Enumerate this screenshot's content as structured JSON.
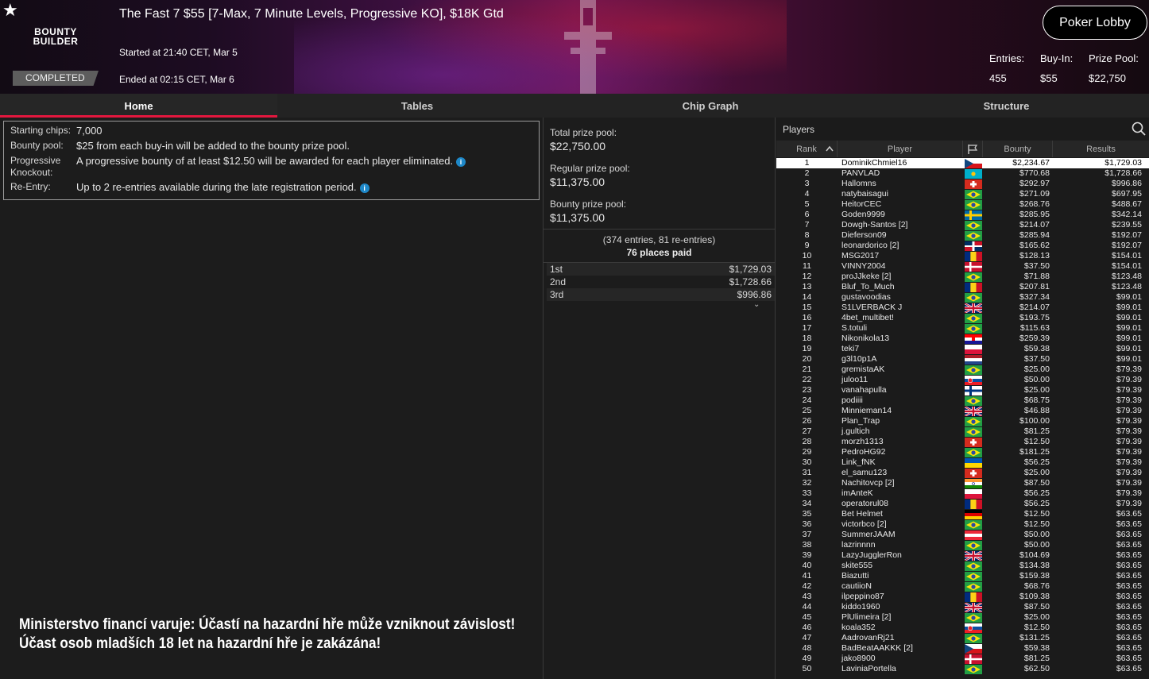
{
  "header": {
    "logo_line1": "BOUNTY",
    "logo_line2": "BUILDER",
    "status": "COMPLETED",
    "title": "The Fast 7 $55 [7-Max, 7 Minute Levels, Progressive KO], $18K Gtd",
    "started": "Started at 21:40 CET, Mar 5",
    "ended": "Ended at 02:15 CET, Mar 6",
    "lobby_button": "Poker Lobby",
    "stats": [
      {
        "label": "Entries:",
        "value": "455"
      },
      {
        "label": "Buy-In:",
        "value": "$55"
      },
      {
        "label": "Prize Pool:",
        "value": "$22,750"
      }
    ]
  },
  "tabs": [
    "Home",
    "Tables",
    "Chip Graph",
    "Structure"
  ],
  "info": {
    "rows": [
      {
        "key": "Starting chips:",
        "value": "7,000",
        "info": false
      },
      {
        "key": "Bounty pool:",
        "value": "$25 from each buy-in will be added to the bounty prize pool.",
        "info": false
      },
      {
        "key": "Progressive Knockout:",
        "value": "A progressive bounty of at least $12.50 will be awarded for each player eliminated.",
        "info": true
      },
      {
        "key": "Re-Entry:",
        "value": "Up to 2 re-entries available during the late registration period.",
        "info": true
      }
    ]
  },
  "warning": {
    "line1": "Ministerstvo financí varuje: Účastí na hazardní hře může vzniknout závislost!",
    "line2": "Účast osob mladších 18 let na hazardní hře je zakázána!"
  },
  "prizes": {
    "total_label": "Total prize pool:",
    "total_value": "$22,750.00",
    "regular_label": "Regular prize pool:",
    "regular_value": "$11,375.00",
    "bounty_label": "Bounty prize pool:",
    "bounty_value": "$11,375.00",
    "entries_note": "(374 entries, 81 re-entries)",
    "places_paid": "76 places paid",
    "payouts": [
      {
        "place": "1st",
        "amount": "$1,729.03"
      },
      {
        "place": "2nd",
        "amount": "$1,728.66"
      },
      {
        "place": "3rd",
        "amount": "$996.86"
      }
    ]
  },
  "players": {
    "title": "Players",
    "columns": {
      "rank": "Rank",
      "player": "Player",
      "bounty": "Bounty",
      "results": "Results"
    },
    "rows": [
      {
        "rank": "1",
        "name": "DominikChmiel16",
        "flag": "cz",
        "bounty": "$2,234.67",
        "result": "$1,729.03"
      },
      {
        "rank": "2",
        "name": "PANVLAD",
        "flag": "kz",
        "bounty": "$770.68",
        "result": "$1,728.66"
      },
      {
        "rank": "3",
        "name": "Hallomns",
        "flag": "ch",
        "bounty": "$292.97",
        "result": "$996.86"
      },
      {
        "rank": "4",
        "name": "natybaisagui",
        "flag": "br",
        "bounty": "$271.09",
        "result": "$697.95"
      },
      {
        "rank": "5",
        "name": "HeitorCEC",
        "flag": "br",
        "bounty": "$268.76",
        "result": "$488.67"
      },
      {
        "rank": "6",
        "name": "Goden9999",
        "flag": "se",
        "bounty": "$285.95",
        "result": "$342.14"
      },
      {
        "rank": "7",
        "name": "Dowgh-Santos [2]",
        "flag": "br",
        "bounty": "$214.07",
        "result": "$239.55"
      },
      {
        "rank": "8",
        "name": "Dieferson09",
        "flag": "br",
        "bounty": "$285.94",
        "result": "$192.07"
      },
      {
        "rank": "9",
        "name": "leonardorico [2]",
        "flag": "do",
        "bounty": "$165.62",
        "result": "$192.07"
      },
      {
        "rank": "10",
        "name": "MSG2017",
        "flag": "ro",
        "bounty": "$128.13",
        "result": "$154.01"
      },
      {
        "rank": "11",
        "name": "VINNY2004",
        "flag": "dk",
        "bounty": "$37.50",
        "result": "$154.01"
      },
      {
        "rank": "12",
        "name": "proJJkeke [2]",
        "flag": "br",
        "bounty": "$71.88",
        "result": "$123.48"
      },
      {
        "rank": "13",
        "name": "Bluf_To_Much",
        "flag": "ro",
        "bounty": "$207.81",
        "result": "$123.48"
      },
      {
        "rank": "14",
        "name": "gustavoodias",
        "flag": "br",
        "bounty": "$327.34",
        "result": "$99.01"
      },
      {
        "rank": "15",
        "name": "S1LVERBACK J",
        "flag": "gb",
        "bounty": "$214.07",
        "result": "$99.01"
      },
      {
        "rank": "16",
        "name": "4bet_multibet!",
        "flag": "br",
        "bounty": "$193.75",
        "result": "$99.01"
      },
      {
        "rank": "17",
        "name": "S.totuli",
        "flag": "br",
        "bounty": "$115.63",
        "result": "$99.01"
      },
      {
        "rank": "18",
        "name": "Nikonikola13",
        "flag": "hr",
        "bounty": "$259.39",
        "result": "$99.01"
      },
      {
        "rank": "19",
        "name": "teki7",
        "flag": "pl",
        "bounty": "$59.38",
        "result": "$99.01"
      },
      {
        "rank": "20",
        "name": "g3l10p1A",
        "flag": "nl",
        "bounty": "$37.50",
        "result": "$99.01"
      },
      {
        "rank": "21",
        "name": "gremistaAK",
        "flag": "br",
        "bounty": "$25.00",
        "result": "$79.39"
      },
      {
        "rank": "22",
        "name": "juloo11",
        "flag": "sk",
        "bounty": "$50.00",
        "result": "$79.39"
      },
      {
        "rank": "23",
        "name": "vanahapulla",
        "flag": "fi",
        "bounty": "$25.00",
        "result": "$79.39"
      },
      {
        "rank": "24",
        "name": "podiiii",
        "flag": "br",
        "bounty": "$68.75",
        "result": "$79.39"
      },
      {
        "rank": "25",
        "name": "Minnieman14",
        "flag": "gb",
        "bounty": "$46.88",
        "result": "$79.39"
      },
      {
        "rank": "26",
        "name": "Plan_Trap",
        "flag": "br",
        "bounty": "$100.00",
        "result": "$79.39"
      },
      {
        "rank": "27",
        "name": "j.gultich",
        "flag": "br",
        "bounty": "$81.25",
        "result": "$79.39"
      },
      {
        "rank": "28",
        "name": "morzh1313",
        "flag": "ch",
        "bounty": "$12.50",
        "result": "$79.39"
      },
      {
        "rank": "29",
        "name": "PedroHG92",
        "flag": "br",
        "bounty": "$181.25",
        "result": "$79.39"
      },
      {
        "rank": "30",
        "name": "Link_fNK",
        "flag": "ua",
        "bounty": "$56.25",
        "result": "$79.39"
      },
      {
        "rank": "31",
        "name": "el_samu123",
        "flag": "ch",
        "bounty": "$25.00",
        "result": "$79.39"
      },
      {
        "rank": "32",
        "name": "Nachitovcp [2]",
        "flag": "in",
        "bounty": "$87.50",
        "result": "$79.39"
      },
      {
        "rank": "33",
        "name": "imAnteK",
        "flag": "pl",
        "bounty": "$56.25",
        "result": "$79.39"
      },
      {
        "rank": "34",
        "name": "operatorul08",
        "flag": "ro",
        "bounty": "$56.25",
        "result": "$79.39"
      },
      {
        "rank": "35",
        "name": "Bet Helmet",
        "flag": "de",
        "bounty": "$12.50",
        "result": "$63.65"
      },
      {
        "rank": "36",
        "name": "victorbco [2]",
        "flag": "br",
        "bounty": "$12.50",
        "result": "$63.65"
      },
      {
        "rank": "37",
        "name": "SummerJAAM",
        "flag": "at",
        "bounty": "$50.00",
        "result": "$63.65"
      },
      {
        "rank": "38",
        "name": "lazrinnnn",
        "flag": "br",
        "bounty": "$50.00",
        "result": "$63.65"
      },
      {
        "rank": "39",
        "name": "LazyJugglerRon",
        "flag": "gb",
        "bounty": "$104.69",
        "result": "$63.65"
      },
      {
        "rank": "40",
        "name": "skite555",
        "flag": "br",
        "bounty": "$134.38",
        "result": "$63.65"
      },
      {
        "rank": "41",
        "name": "Biazutti",
        "flag": "br",
        "bounty": "$159.38",
        "result": "$63.65"
      },
      {
        "rank": "42",
        "name": "cautiioN",
        "flag": "br",
        "bounty": "$68.76",
        "result": "$63.65"
      },
      {
        "rank": "43",
        "name": "ilpeppino87",
        "flag": "ro",
        "bounty": "$109.38",
        "result": "$63.65"
      },
      {
        "rank": "44",
        "name": "kiddo1960",
        "flag": "gb",
        "bounty": "$87.50",
        "result": "$63.65"
      },
      {
        "rank": "45",
        "name": "PlUlimeira [2]",
        "flag": "br",
        "bounty": "$25.00",
        "result": "$63.65"
      },
      {
        "rank": "46",
        "name": "koala352",
        "flag": "sk",
        "bounty": "$12.50",
        "result": "$63.65"
      },
      {
        "rank": "47",
        "name": "AadrovanRj21",
        "flag": "br",
        "bounty": "$131.25",
        "result": "$63.65"
      },
      {
        "rank": "48",
        "name": "BadBeatAAKKK [2]",
        "flag": "cz",
        "bounty": "$59.38",
        "result": "$63.65"
      },
      {
        "rank": "49",
        "name": "jako8900",
        "flag": "dk",
        "bounty": "$81.25",
        "result": "$63.65"
      },
      {
        "rank": "50",
        "name": "LaviniaPortella",
        "flag": "br",
        "bounty": "$62.50",
        "result": "$63.65"
      }
    ]
  }
}
